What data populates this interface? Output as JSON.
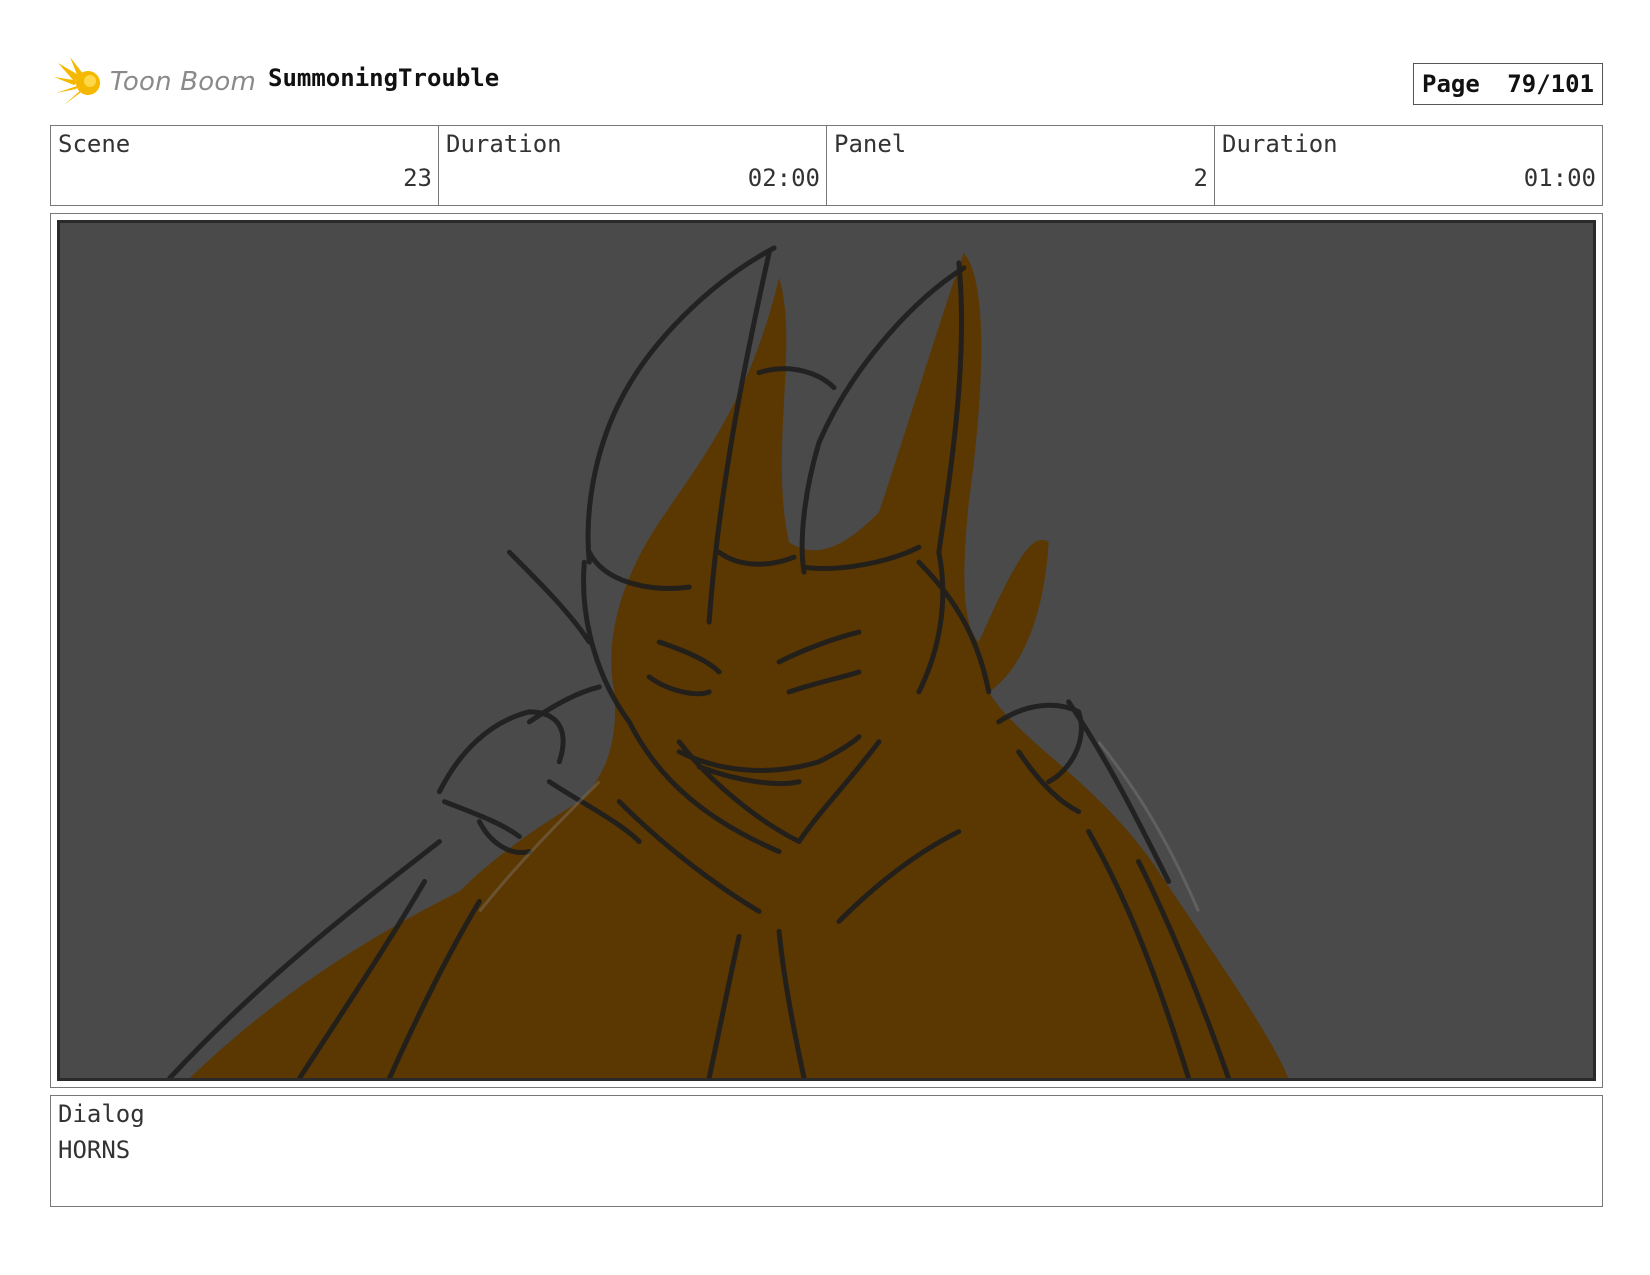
{
  "header": {
    "logo_text": "Toon Boom",
    "project_title": "SummoningTrouble",
    "page_label": "Page",
    "page_number": "79/101"
  },
  "info": {
    "scene_label": "Scene",
    "scene_value": "23",
    "scene_duration_label": "Duration",
    "scene_duration_value": "02:00",
    "panel_label": "Panel",
    "panel_value": "2",
    "panel_duration_label": "Duration",
    "panel_duration_value": "01:00"
  },
  "dialog": {
    "label": "Dialog",
    "text": "HORNS"
  },
  "colors": {
    "panel_background": "#4a4a4a",
    "figure_fill": "#5c3700",
    "sketch_line": "#1e1e1e",
    "logo_accent": "#f5b800"
  }
}
